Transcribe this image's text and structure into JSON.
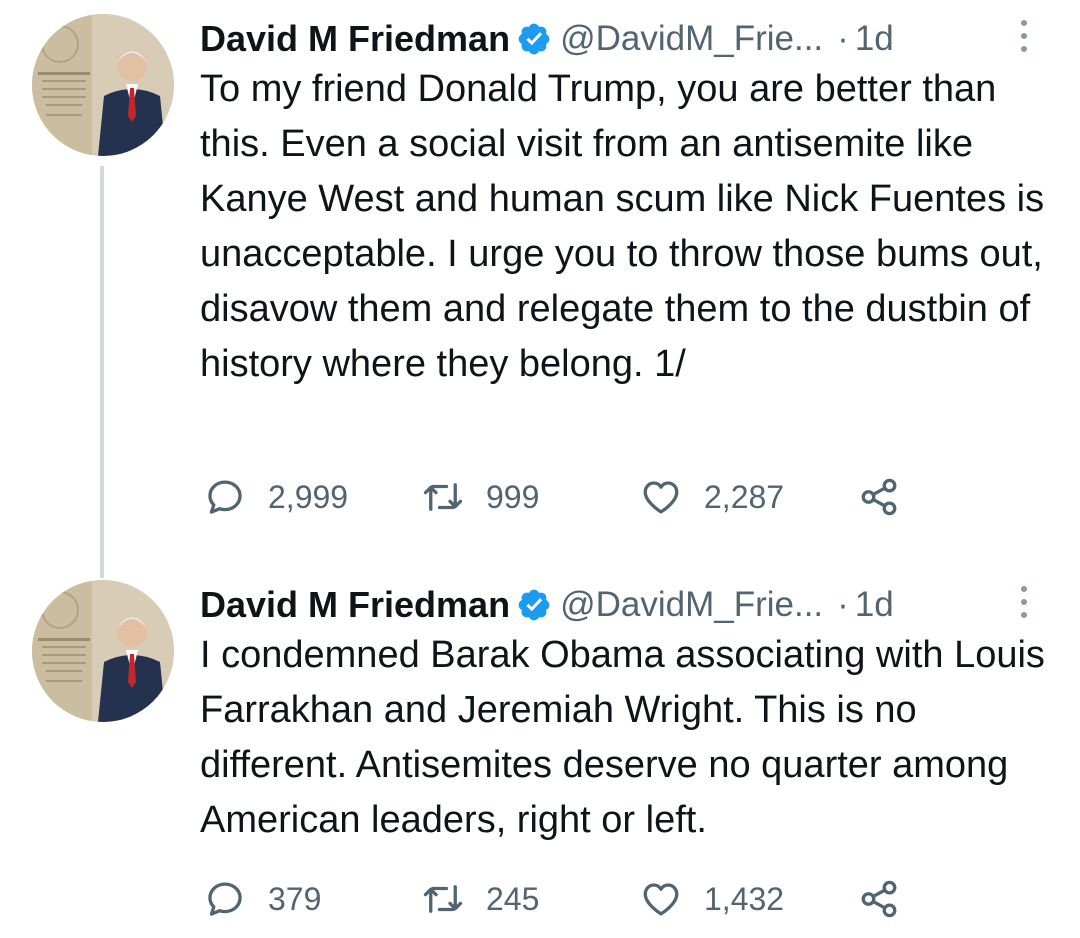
{
  "tweets": [
    {
      "author_name": "David M Friedman",
      "handle": "@DavidM_Frie...",
      "separator": "·",
      "time": "1d",
      "text": "To my friend Donald Trump, you are better than this. Even a social visit from an antisemite like Kanye West and human scum like Nick Fuentes is unacceptable. I urge you to throw those bums out, disavow them and relegate them to the dustbin of history where they belong. 1/",
      "replies": "2,999",
      "retweets": "999",
      "likes": "2,287"
    },
    {
      "author_name": "David M Friedman",
      "handle": "@DavidM_Frie...",
      "separator": "·",
      "time": "1d",
      "text": "I condemned Barak Obama associating with Louis Farrakhan and Jeremiah Wright. This is no different. Antisemites deserve no quarter among American leaders, right or left.",
      "replies": "379",
      "retweets": "245",
      "likes": "1,432"
    }
  ],
  "colors": {
    "text": "#0f1419",
    "secondary": "#536471",
    "verified": "#1d9bf0",
    "thread_line": "#cfd9de"
  },
  "icons": [
    "verified-badge-icon",
    "more-icon",
    "reply-icon",
    "retweet-icon",
    "like-icon",
    "share-icon"
  ]
}
